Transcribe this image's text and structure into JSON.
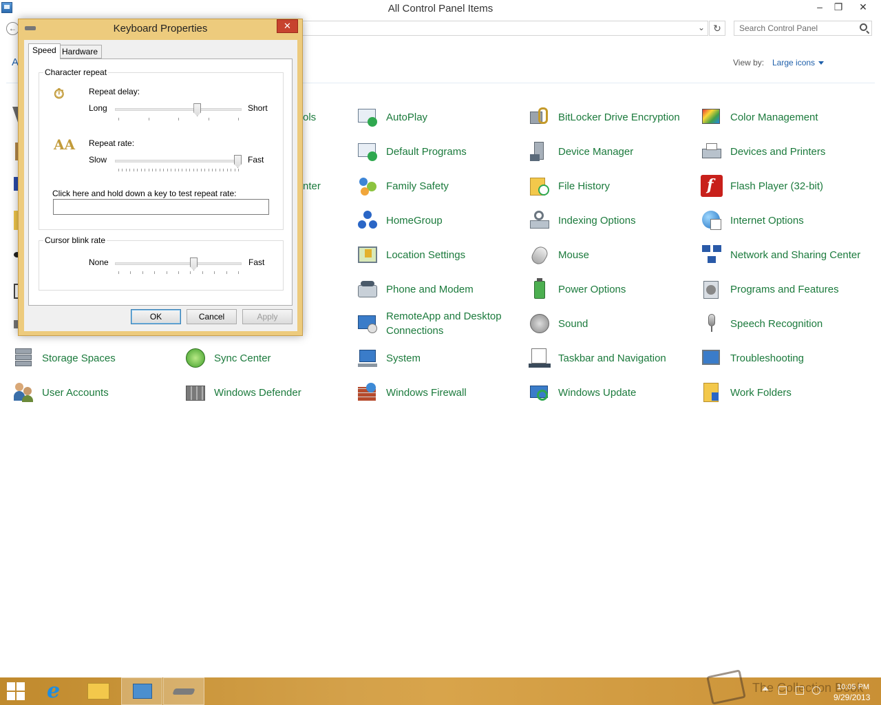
{
  "window": {
    "title": "All Control Panel Items",
    "minimize": "–",
    "restore": "❐",
    "close": "✕"
  },
  "toolbar": {
    "back": "←",
    "refresh": "↻",
    "dropdown": "⌄",
    "search_placeholder": "Search Control Panel"
  },
  "header": {
    "heading_fragment": "A",
    "view_by_label": "View by:",
    "view_by_value": "Large icons"
  },
  "partial_items": {
    "row1_fragment": "ols",
    "row3_fragment": "nter"
  },
  "items": [
    {
      "label": "AutoPlay",
      "icon": "autoplay-icon"
    },
    {
      "label": "BitLocker Drive Encryption",
      "icon": "bitlocker-icon"
    },
    {
      "label": "Color Management",
      "icon": "color-management-icon"
    },
    {
      "label": "Default Programs",
      "icon": "default-programs-icon"
    },
    {
      "label": "Device Manager",
      "icon": "device-manager-icon"
    },
    {
      "label": "Devices and Printers",
      "icon": "printer-icon"
    },
    {
      "label": "Family Safety",
      "icon": "family-safety-icon"
    },
    {
      "label": "File History",
      "icon": "file-history-icon"
    },
    {
      "label": "Flash Player (32-bit)",
      "icon": "flash-icon"
    },
    {
      "label": "HomeGroup",
      "icon": "homegroup-icon"
    },
    {
      "label": "Indexing Options",
      "icon": "indexing-icon"
    },
    {
      "label": "Internet Options",
      "icon": "internet-options-icon"
    },
    {
      "label": "Location Settings",
      "icon": "location-icon"
    },
    {
      "label": "Mouse",
      "icon": "mouse-icon"
    },
    {
      "label": "Network and Sharing Center",
      "icon": "network-icon"
    },
    {
      "label": "Phone and Modem",
      "icon": "phone-icon"
    },
    {
      "label": "Power Options",
      "icon": "power-icon"
    },
    {
      "label": "Programs and Features",
      "icon": "programs-icon"
    },
    {
      "label": "RemoteApp and Desktop Connections",
      "icon": "remoteapp-icon"
    },
    {
      "label": "Sound",
      "icon": "sound-icon"
    },
    {
      "label": "Speech Recognition",
      "icon": "microphone-icon"
    },
    {
      "label": "Storage Spaces",
      "icon": "storage-icon"
    },
    {
      "label": "Sync Center",
      "icon": "sync-icon"
    },
    {
      "label": "System",
      "icon": "system-icon"
    },
    {
      "label": "Taskbar and Navigation",
      "icon": "taskbar-icon"
    },
    {
      "label": "Troubleshooting",
      "icon": "troubleshooting-icon"
    },
    {
      "label": "User Accounts",
      "icon": "user-accounts-icon"
    },
    {
      "label": "Windows Defender",
      "icon": "defender-icon"
    },
    {
      "label": "Windows Firewall",
      "icon": "firewall-icon"
    },
    {
      "label": "Windows Update",
      "icon": "update-icon"
    },
    {
      "label": "Work Folders",
      "icon": "work-folders-icon"
    }
  ],
  "dialog": {
    "title": "Keyboard Properties",
    "close": "✕",
    "tabs": [
      "Speed",
      "Hardware"
    ],
    "character_repeat": {
      "group_label": "Character repeat",
      "repeat_delay_label": "Repeat delay:",
      "delay_min": "Long",
      "delay_max": "Short",
      "delay_level": 0.66,
      "repeat_rate_label": "Repeat rate:",
      "rate_min": "Slow",
      "rate_max": "Fast",
      "rate_level": 1.0,
      "test_label": "Click here and hold down a key to test repeat rate:",
      "test_value": ""
    },
    "cursor_blink": {
      "group_label": "Cursor blink rate",
      "min": "None",
      "max": "Fast",
      "level": 0.63
    },
    "buttons": {
      "ok": "OK",
      "cancel": "Cancel",
      "apply": "Apply"
    }
  },
  "taskbar": {
    "time": "10:05 PM",
    "date": "9/29/2013",
    "watermark": "The Collection Book"
  }
}
